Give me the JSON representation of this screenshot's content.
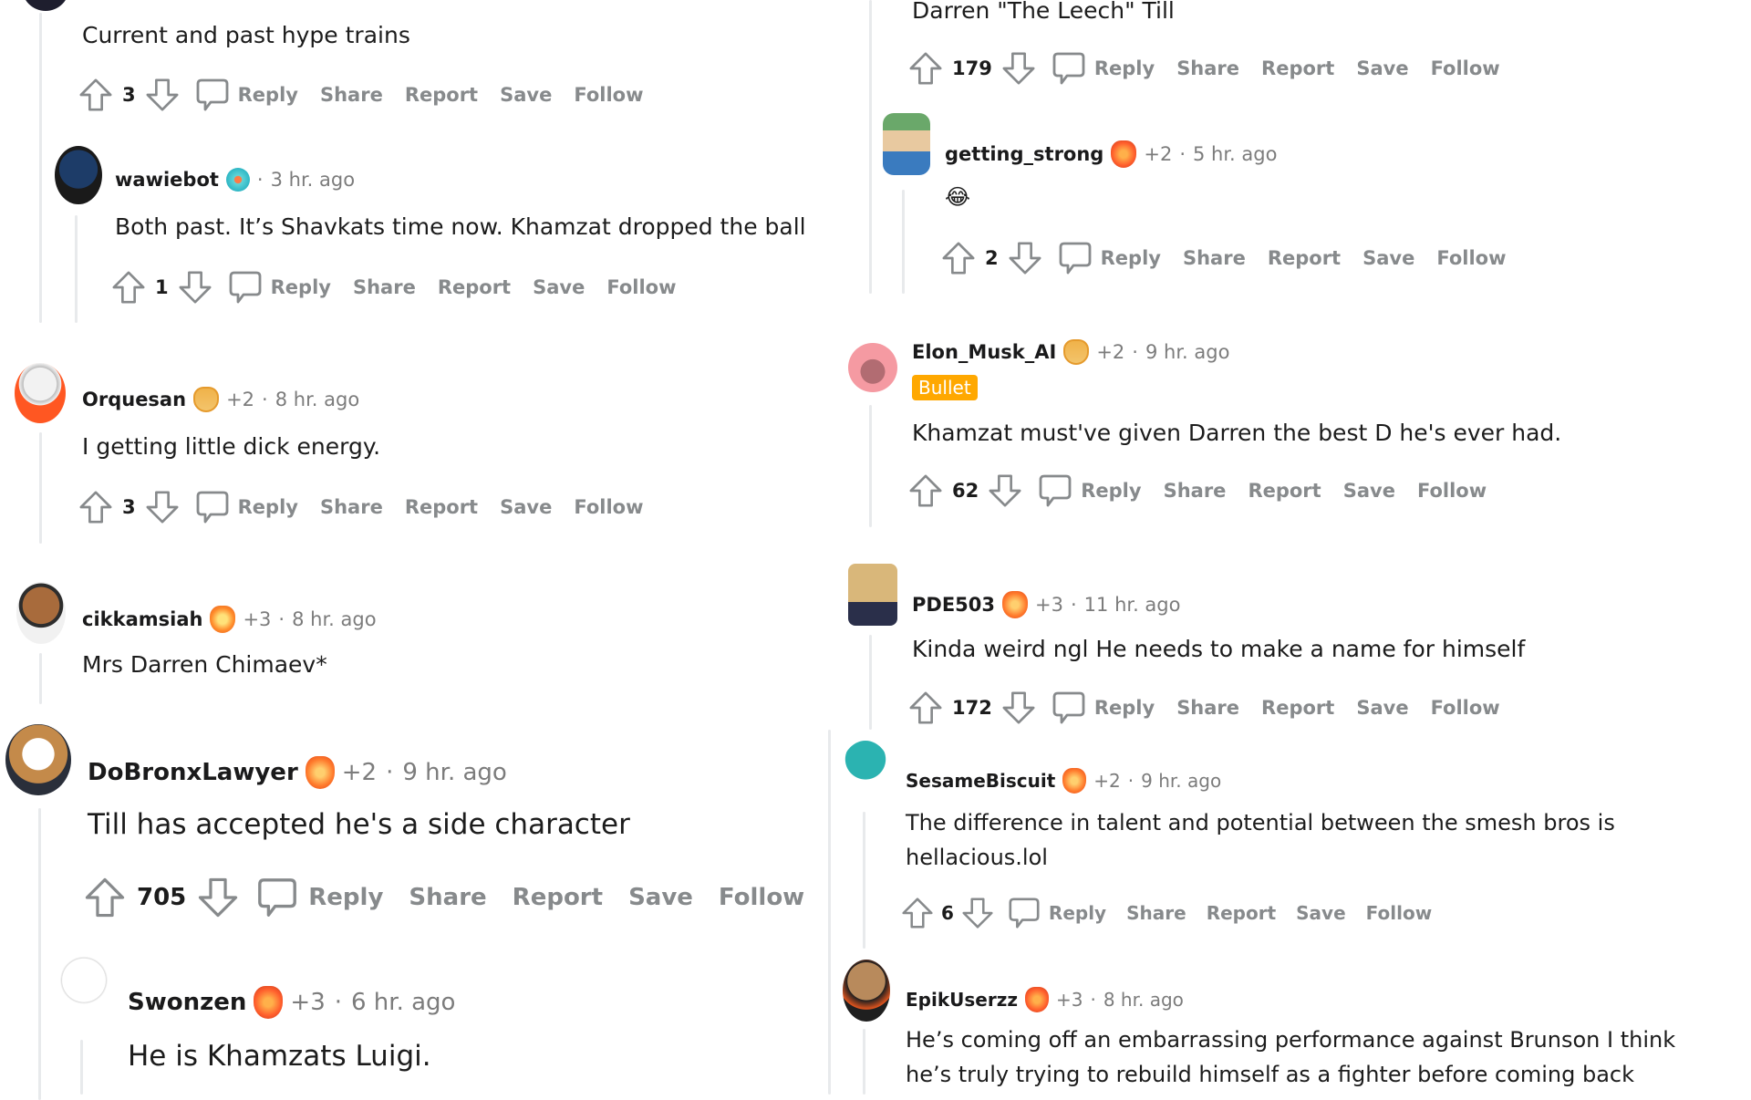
{
  "actions": {
    "reply": "Reply",
    "share": "Share",
    "report": "Report",
    "save": "Save",
    "follow": "Follow"
  },
  "left": {
    "top_comment": {
      "body": "Current and past hype trains",
      "score": "3"
    },
    "comments": [
      {
        "user": "wawiebot",
        "extra": "",
        "time": "3 hr. ago",
        "body": "Both past. It’s Shavkats time now. Khamzat dropped the ball",
        "score": "1"
      },
      {
        "user": "Orquesan",
        "extra": "+2",
        "time": "8 hr. ago",
        "body": "I getting little dick energy.",
        "score": "3"
      },
      {
        "user": "cikkamsiah",
        "extra": "+3",
        "time": "8 hr. ago",
        "body": "Mrs Darren Chimaev*"
      },
      {
        "user": "DoBronxLawyer",
        "extra": "+2",
        "time": "9 hr. ago",
        "body": "Till has accepted he's a side character",
        "score": "705"
      },
      {
        "user": "Swonzen",
        "extra": "+3",
        "time": "6 hr. ago",
        "body": "He is Khamzats Luigi."
      }
    ]
  },
  "right": {
    "top_comment": {
      "body": "Darren \"The Leech\" Till",
      "score": "179"
    },
    "comments": [
      {
        "user": "getting_strong",
        "extra": "+2",
        "time": "5 hr. ago",
        "body": "😂",
        "score": "2"
      },
      {
        "user": "Elon_Musk_AI",
        "extra": "+2",
        "time": "9 hr. ago",
        "flair_text": "Bullet",
        "body": "Khamzat must've given Darren the best D he's ever had.",
        "score": "62"
      },
      {
        "user": "PDE503",
        "extra": "+3",
        "time": "11 hr. ago",
        "body": "Kinda weird ngl He needs to make a name for himself",
        "score": "172"
      },
      {
        "user": "SesameBiscuit",
        "extra": "+2",
        "time": "9 hr. ago",
        "body_line1": "The difference in talent and potential between the smesh bros is",
        "body_line2": "hellacious.lol",
        "score": "6"
      },
      {
        "user": "EpikUserzz",
        "extra": "+3",
        "time": "8 hr. ago",
        "body_line1": "He’s coming off an embarrassing performance against Brunson I think",
        "body_line2": "he’s truly trying to rebuild himself as a fighter before coming back"
      }
    ]
  },
  "separator": "·",
  "colors": {
    "flair_badge": "#ffa800",
    "action_text": "#878a8c",
    "thread_line": "#e8eaec"
  }
}
